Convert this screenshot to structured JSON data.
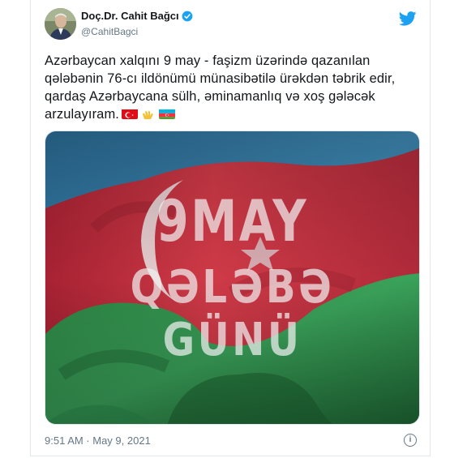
{
  "author": {
    "display_name": "Doç.Dr. Cahit Bağcı",
    "handle": "@CahitBagci",
    "verified": true
  },
  "tweet": {
    "text": "Azərbaycan xalqını 9 may - faşizm üzərində qazanılan qələbənin 76-cı ildönümü münasibətilə ürəkdən təbrik edir, qardaş Azərbaycana sülh, əminamanlıq və xoş gələcək arzulayıram.",
    "emojis": [
      "turkey-flag",
      "clapping-hands",
      "azerbaijan-flag"
    ]
  },
  "media": {
    "title_line1": "9MAY",
    "title_line2": "QƏLƏBƏ GÜNÜ"
  },
  "footer": {
    "timestamp": "9:51 AM · May 9, 2021",
    "info_symbol": "i"
  },
  "colors": {
    "twitter_blue": "#1da1f2",
    "flag_blue": "#2f6f95",
    "flag_red": "#c2303f",
    "flag_green": "#2f8e4c",
    "text_primary": "#14171a",
    "text_secondary": "#657786"
  }
}
